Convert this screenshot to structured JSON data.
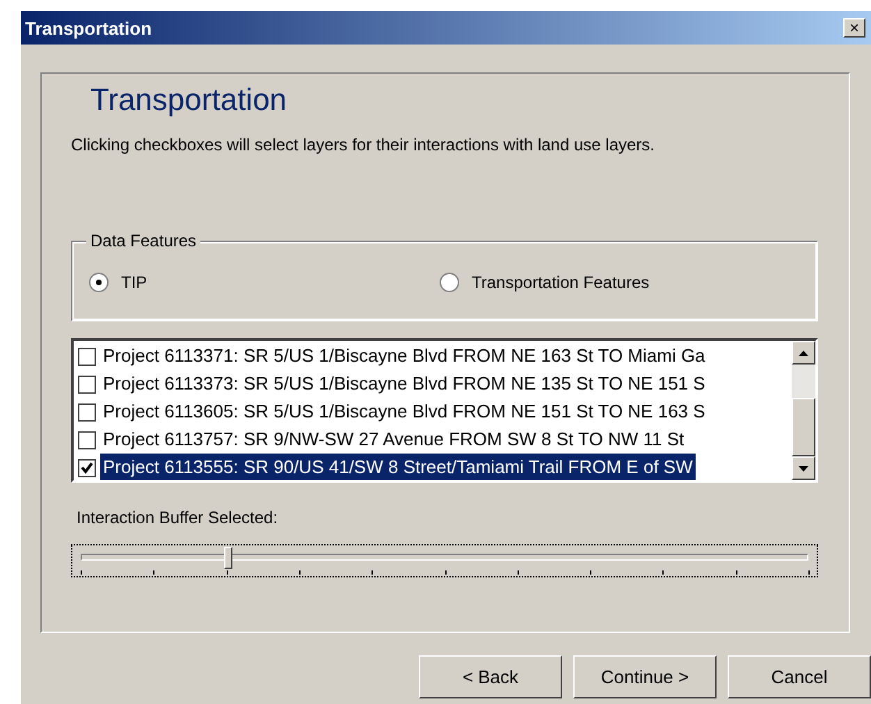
{
  "window": {
    "title": "Transportation",
    "close": "×"
  },
  "heading": "Transportation",
  "description": "Clicking checkboxes will select layers for their interactions with land use layers.",
  "data_features": {
    "legend": "Data Features",
    "options": [
      {
        "label": "TIP",
        "selected": true
      },
      {
        "label": "Transportation Features",
        "selected": false
      }
    ]
  },
  "projects": [
    {
      "label": "Project 6113371: SR 5/US 1/Biscayne Blvd FROM NE 163 St TO Miami Ga",
      "checked": false,
      "selected": false
    },
    {
      "label": "Project 6113373: SR 5/US 1/Biscayne Blvd FROM NE 135 St TO NE 151 S",
      "checked": false,
      "selected": false
    },
    {
      "label": "Project 6113605: SR 5/US 1/Biscayne Blvd FROM NE 151 St TO NE 163 S",
      "checked": false,
      "selected": false
    },
    {
      "label": "Project 6113757: SR 9/NW-SW 27 Avenue FROM SW 8 St TO NW 11 St",
      "checked": false,
      "selected": false
    },
    {
      "label": "Project 6113555: SR 90/US 41/SW 8 Street/Tamiami Trail FROM E of SW",
      "checked": true,
      "selected": true
    }
  ],
  "buffer": {
    "label": "Interaction Buffer Selected:",
    "level": 0.2
  },
  "buttons": [
    "< Back",
    "Continue >",
    "Cancel"
  ]
}
